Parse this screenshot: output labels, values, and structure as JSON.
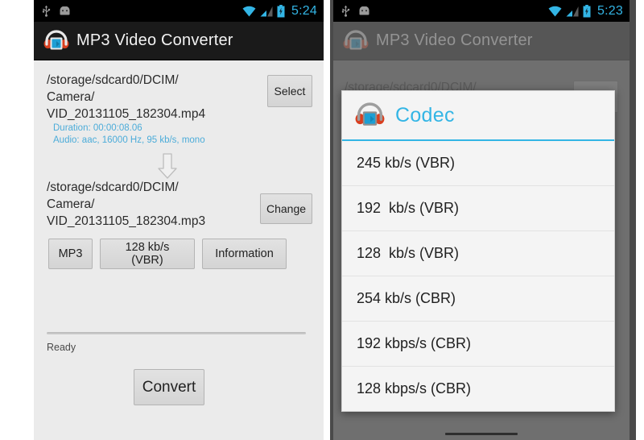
{
  "left_phone": {
    "status_bar": {
      "clock": "5:24",
      "icons": [
        "usb-icon",
        "android-icon",
        "wifi-icon",
        "signal-icon",
        "battery-icon"
      ]
    },
    "action_bar": {
      "title": "MP3 Video Converter",
      "icon": "app-headphones-icon"
    },
    "source": {
      "path": "/storage/sdcard0/DCIM/\nCamera/\nVID_20131105_182304.mp4",
      "select_button": "Select",
      "duration_info": "Duration: 00:00:08.06",
      "audio_info": "Audio: aac, 16000 Hz, 95 kb/s, mono"
    },
    "arrow": "arrow-down-icon",
    "output": {
      "path": "/storage/sdcard0/DCIM/\nCamera/\nVID_20131105_182304.mp3",
      "change_button": "Change"
    },
    "options": {
      "format_button": "MP3",
      "bitrate_button": "128  kb/s (VBR)",
      "information_button": "Information"
    },
    "status_text": "Ready",
    "convert_button": "Convert"
  },
  "right_phone": {
    "status_bar": {
      "clock": "5:23",
      "icons": [
        "usb-icon",
        "android-icon",
        "wifi-icon",
        "signal-icon",
        "battery-icon"
      ]
    },
    "action_bar": {
      "title": "MP3 Video Converter",
      "icon": "app-headphones-icon"
    },
    "background": {
      "path": "/storage/sdcard0/DCIM/",
      "select_button": ""
    },
    "dialog": {
      "title": "Codec",
      "icon": "app-headphones-icon",
      "items": [
        "245 kb/s (VBR)",
        "192  kb/s (VBR)",
        "128  kb/s (VBR)",
        "254 kb/s (CBR)",
        "192 kbps/s (CBR)",
        "128 kbps/s (CBR)"
      ]
    }
  },
  "colors": {
    "accent_blue": "#33b5e5",
    "info_blue": "#4cacd9",
    "action_bar": "#1a1a1a",
    "screen_bg": "#ebebeb",
    "dialog_bg": "#f4f4f4",
    "scrim": "#6f6f6f"
  }
}
